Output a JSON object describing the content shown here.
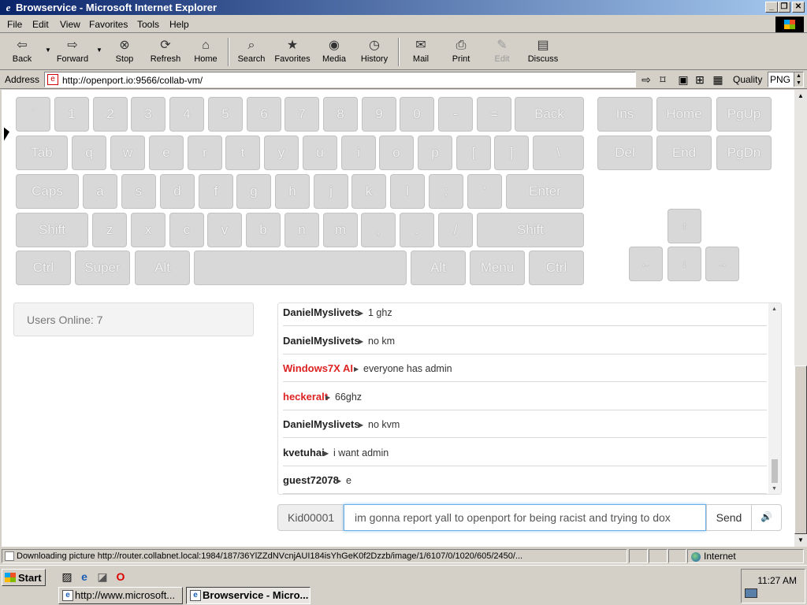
{
  "window": {
    "title": "Browservice - Microsoft Internet Explorer",
    "buttons": [
      "_",
      "❐",
      "✕"
    ]
  },
  "menu": [
    "File",
    "Edit",
    "View",
    "Favorites",
    "Tools",
    "Help"
  ],
  "toolbar": [
    {
      "label": "Back",
      "icon": "back-arrow-icon",
      "glyph": "⇦"
    },
    {
      "label": "Forward",
      "icon": "forward-arrow-icon",
      "glyph": "⇨"
    },
    {
      "label": "Stop",
      "icon": "stop-icon",
      "glyph": "⊗"
    },
    {
      "label": "Refresh",
      "icon": "refresh-icon",
      "glyph": "⟳"
    },
    {
      "label": "Home",
      "icon": "home-icon",
      "glyph": "⌂"
    },
    {
      "label": "Search",
      "icon": "search-icon",
      "glyph": "⌕"
    },
    {
      "label": "Favorites",
      "icon": "favorites-icon",
      "glyph": "★"
    },
    {
      "label": "Media",
      "icon": "media-icon",
      "glyph": "◉"
    },
    {
      "label": "History",
      "icon": "history-icon",
      "glyph": "◷"
    },
    {
      "label": "Mail",
      "icon": "mail-icon",
      "glyph": "✉"
    },
    {
      "label": "Print",
      "icon": "print-icon",
      "glyph": "⎙"
    },
    {
      "label": "Edit",
      "icon": "edit-icon",
      "glyph": "✎",
      "disabled": true
    },
    {
      "label": "Discuss",
      "icon": "discuss-icon",
      "glyph": "▤"
    }
  ],
  "address": {
    "label": "Address",
    "url": "http://openport.io:9566/collab-vm/",
    "quality_label": "Quality",
    "quality_value": "PNG"
  },
  "keyboard": {
    "rows": [
      [
        "`",
        "1",
        "2",
        "3",
        "4",
        "5",
        "6",
        "7",
        "8",
        "9",
        "0",
        "-",
        "=",
        "Back"
      ],
      [
        "Tab",
        "q",
        "w",
        "e",
        "r",
        "t",
        "y",
        "u",
        "i",
        "o",
        "p",
        "[",
        "]",
        "\\"
      ],
      [
        "Caps",
        "a",
        "s",
        "d",
        "f",
        "g",
        "h",
        "j",
        "k",
        "l",
        ";",
        "'",
        "Enter"
      ],
      [
        "Shift",
        "z",
        "x",
        "c",
        "v",
        "b",
        "n",
        "m",
        ",",
        ".",
        "/",
        "Shift"
      ],
      [
        "Ctrl",
        "Super",
        "Alt",
        "",
        "Alt",
        "Menu",
        "Ctrl"
      ]
    ],
    "nav": [
      [
        "Ins",
        "Home",
        "PgUp"
      ],
      [
        "Del",
        "End",
        "PgDn"
      ]
    ],
    "arrows": [
      "↑",
      "←",
      "↓",
      "→"
    ]
  },
  "users_online": "Users Online: 7",
  "chat": {
    "messages": [
      {
        "user": "DanielMyslivets",
        "text": "1 ghz",
        "red": false
      },
      {
        "user": "DanielMyslivets",
        "text": "no km",
        "red": false
      },
      {
        "user": "Windows7X AI",
        "text": "everyone has admin",
        "red": true
      },
      {
        "user": "heckeralt",
        "text": "66ghz",
        "red": true
      },
      {
        "user": "DanielMyslivets",
        "text": "no kvm",
        "red": false
      },
      {
        "user": "kvetuhai",
        "text": "i want admin",
        "red": false
      },
      {
        "user": "guest72078",
        "text": "e",
        "red": false
      }
    ],
    "username": "Kid00001",
    "input_value": "im gonna report yall to openport for being racist and trying to dox",
    "send_label": "Send",
    "volume_icon": "🔊"
  },
  "status": {
    "text": "Downloading picture http://router.collabnet.local:1984/187/36YlZZdNVcnjAUI184isYhGeK0f2Dzzb/image/1/6107/0/1020/605/2450/...",
    "zone": "Internet"
  },
  "taskbar": {
    "start": "Start",
    "tasks": [
      {
        "label": "http://www.microsoft...",
        "active": false
      },
      {
        "label": "Browservice - Micro...",
        "active": true
      }
    ],
    "clock": "11:27 AM"
  }
}
